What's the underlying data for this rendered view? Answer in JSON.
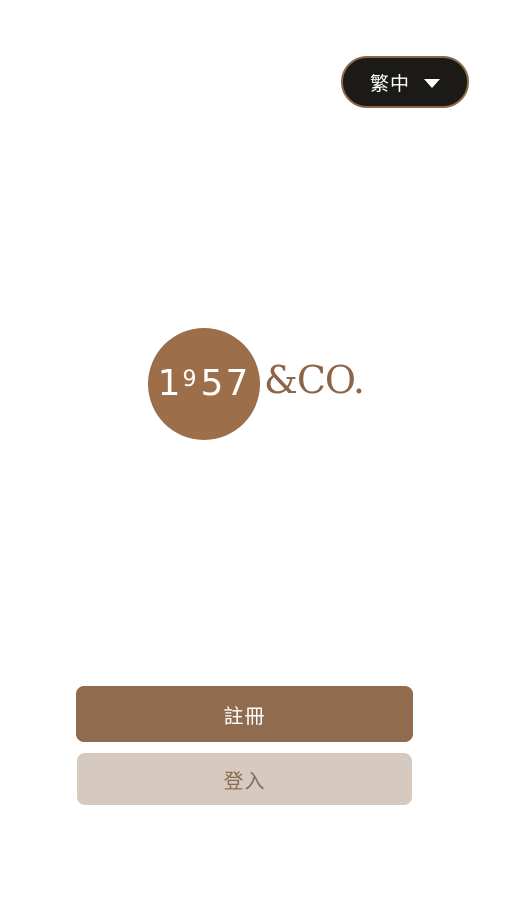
{
  "language_selector": {
    "selected": "繁中",
    "icon": "caret-down-icon"
  },
  "logo": {
    "year_first": "1",
    "year_sup": "9",
    "year_rest": "57",
    "suffix": "&CO.",
    "circle_color": "#9c6e4a"
  },
  "actions": {
    "register_label": "註冊",
    "login_label": "登入"
  },
  "colors": {
    "primary": "#916b4d",
    "secondary": "#d6cac0",
    "pill_background": "#1c1a16"
  }
}
